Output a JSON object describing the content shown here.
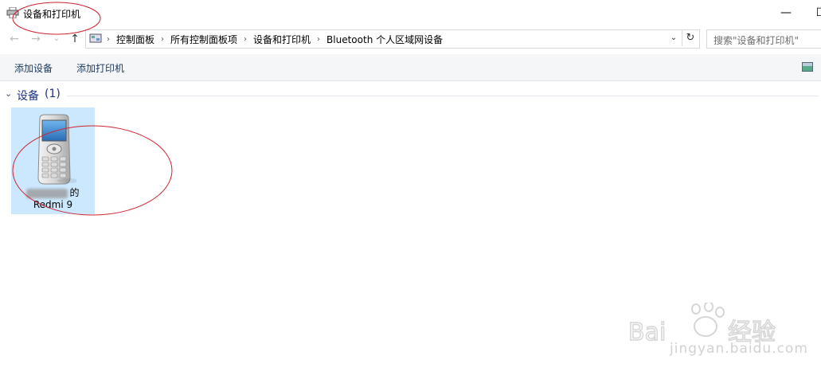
{
  "window": {
    "title": "设备和打印机",
    "minimize_glyph": "—",
    "maximize_glyph": "☐"
  },
  "address_bar": {
    "breadcrumbs": [
      "控制面板",
      "所有控制面板项",
      "设备和打印机",
      "Bluetooth 个人区域网设备"
    ],
    "separator": "›",
    "dropdown_glyph": "⌄",
    "refresh_glyph": "↻"
  },
  "search": {
    "placeholder": "搜索\"设备和打印机\""
  },
  "nav": {
    "back_glyph": "←",
    "forward_glyph": "→",
    "history_glyph": "⌄",
    "up_glyph": "↑"
  },
  "toolbar": {
    "add_device_label": "添加设备",
    "add_printer_label": "添加打印机",
    "view_icon": "view-options-icon"
  },
  "devices_group": {
    "title": "设备",
    "count": "(1)",
    "chevron": "⌄",
    "items": [
      {
        "owner_suffix": "的",
        "name": "Redmi 9",
        "icon": "mobile-phone-icon"
      }
    ]
  },
  "watermark": {
    "brand": "Bai du 经验",
    "url": "jingyan.baidu.com"
  },
  "colors": {
    "selection_bg": "#cce8ff",
    "group_title": "#1e3287",
    "annotation_red": "#d0212e"
  }
}
